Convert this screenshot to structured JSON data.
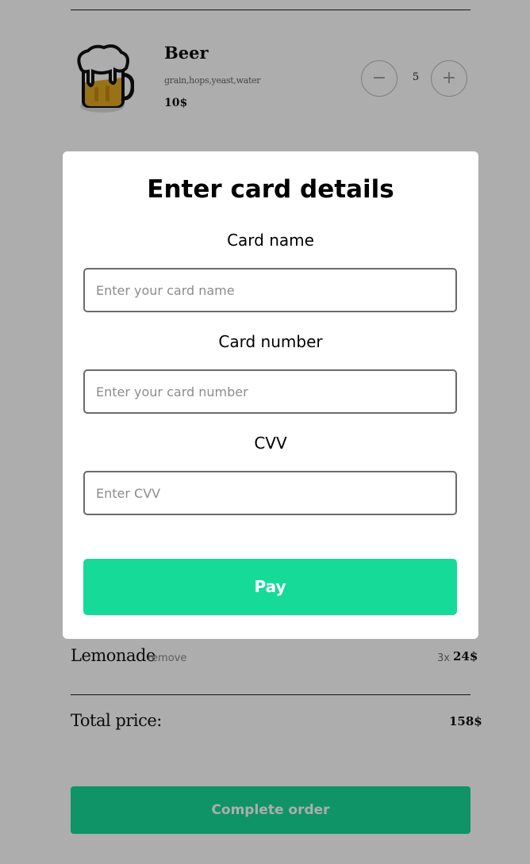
{
  "cart": {
    "product": {
      "name": "Beer",
      "ingredients": "grain,hops,yeast,water",
      "price": "10$",
      "quantity": "5",
      "minus_label": "−",
      "plus_label": "+",
      "icon": "beer-mug-icon"
    },
    "line_items": [
      {
        "name": "Lemonade",
        "remove_label": "remove",
        "qty": "3x",
        "price": "24$"
      }
    ],
    "total_label": "Total price:",
    "total_value": "158$",
    "complete_button": "Complete order"
  },
  "modal": {
    "title": "Enter card details",
    "card_name_label": "Card name",
    "card_name_placeholder": "Enter your card name",
    "card_number_label": "Card number",
    "card_number_placeholder": "Enter your card number",
    "cvv_label": "CVV",
    "cvv_placeholder": "Enter CVV",
    "pay_button": "Pay"
  },
  "colors": {
    "accent": "#16db98",
    "overlay": "rgba(0,0,0,0.32)",
    "modal_bg": "#ffffff",
    "page_bg": "#ffffff"
  }
}
